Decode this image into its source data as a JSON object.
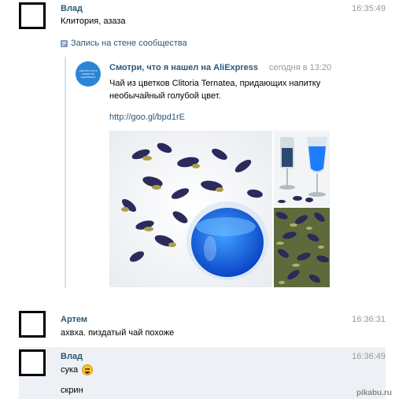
{
  "messages": [
    {
      "author": "Влад",
      "time": "16:35:49",
      "text": "Клитория, азаза"
    },
    {
      "author": "Артем",
      "time": "16:36:31",
      "text": "ахвха. пиздатый чай похоже"
    },
    {
      "author": "Влад",
      "time": "16:36:49",
      "text": "сука",
      "text2": "скрин"
    }
  ],
  "wall_post": {
    "label": "Запись на стене сообщества",
    "publisher": "Смотри, что я нашел на AliExpress",
    "date": "сегодня в 13:20",
    "logo_text": "СМОТРИ ЧТО Я НАШЕЛ НА ALIEXPRESS",
    "text": "Чай из цветков Clitoria Ternatea, придающих напитку необычайный голубой цвет.",
    "link": "http://goo.gl/bpd1rE"
  },
  "icons": {
    "wall": "wall-post-icon",
    "emoji": "laughing-emoji-icon"
  },
  "colors": {
    "link": "#2b587a",
    "time": "#999999",
    "highlight": "#edf1f5",
    "accent": "#2c84d6"
  },
  "watermark": "pikabu.ru"
}
